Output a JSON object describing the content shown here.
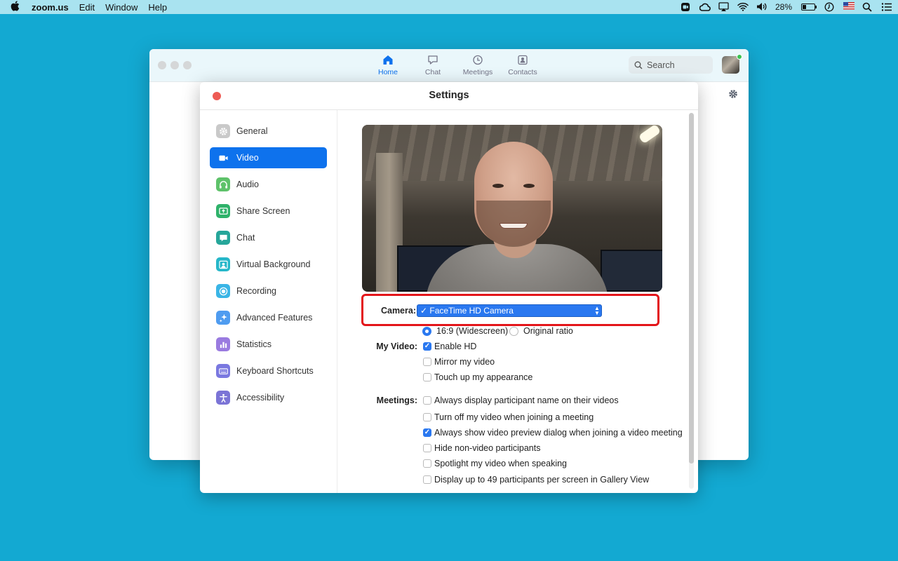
{
  "menubar": {
    "app_name": "zoom.us",
    "items": [
      "Edit",
      "Window",
      "Help"
    ],
    "battery": "28%"
  },
  "zoom": {
    "tabs": [
      {
        "label": "Home",
        "icon": "home-icon",
        "active": true
      },
      {
        "label": "Chat",
        "icon": "chat-bubble-icon",
        "active": false
      },
      {
        "label": "Meetings",
        "icon": "clock-icon",
        "active": false
      },
      {
        "label": "Contacts",
        "icon": "contact-card-icon",
        "active": false
      }
    ],
    "search_placeholder": "Search"
  },
  "settings": {
    "title": "Settings",
    "nav": [
      {
        "label": "General",
        "icon": "gear-icon",
        "color": "#c9c9c9",
        "active": false
      },
      {
        "label": "Video",
        "icon": "video-camera-icon",
        "color": "#0e72ed",
        "active": true
      },
      {
        "label": "Audio",
        "icon": "headphones-icon",
        "color": "#5ec26a",
        "active": false
      },
      {
        "label": "Share Screen",
        "icon": "share-screen-icon",
        "color": "#2fb26a",
        "active": false
      },
      {
        "label": "Chat",
        "icon": "chat-icon",
        "color": "#26a69a",
        "active": false
      },
      {
        "label": "Virtual Background",
        "icon": "person-background-icon",
        "color": "#26b7c9",
        "active": false
      },
      {
        "label": "Recording",
        "icon": "record-icon",
        "color": "#3ab5e6",
        "active": false
      },
      {
        "label": "Advanced Features",
        "icon": "sparkle-icon",
        "color": "#4f9cf0",
        "active": false
      },
      {
        "label": "Statistics",
        "icon": "bar-chart-icon",
        "color": "#9a7be0",
        "active": false
      },
      {
        "label": "Keyboard Shortcuts",
        "icon": "keyboard-icon",
        "color": "#7a78e0",
        "active": false
      },
      {
        "label": "Accessibility",
        "icon": "accessibility-icon",
        "color": "#7b74d6",
        "active": false
      }
    ],
    "video": {
      "camera_label": "Camera:",
      "camera_value": "✓ FaceTime HD Camera",
      "aspect_options": [
        {
          "label": "16:9 (Widescreen)",
          "selected": true
        },
        {
          "label": "Original ratio",
          "selected": false
        }
      ],
      "my_video_label": "My Video:",
      "my_video_options": [
        {
          "label": "Enable HD",
          "checked": true
        },
        {
          "label": "Mirror my video",
          "checked": false
        },
        {
          "label": "Touch up my appearance",
          "checked": false
        }
      ],
      "meetings_label": "Meetings:",
      "meetings_options": [
        {
          "label": "Always display participant name on their videos",
          "checked": false
        },
        {
          "label": "Turn off my video when joining a meeting",
          "checked": false
        },
        {
          "label": "Always show video preview dialog when joining a video meeting",
          "checked": true
        },
        {
          "label": "Hide non-video participants",
          "checked": false
        },
        {
          "label": "Spotlight my video when speaking",
          "checked": false
        },
        {
          "label": "Display up to 49 participants per screen in Gallery View",
          "checked": false
        }
      ]
    }
  }
}
